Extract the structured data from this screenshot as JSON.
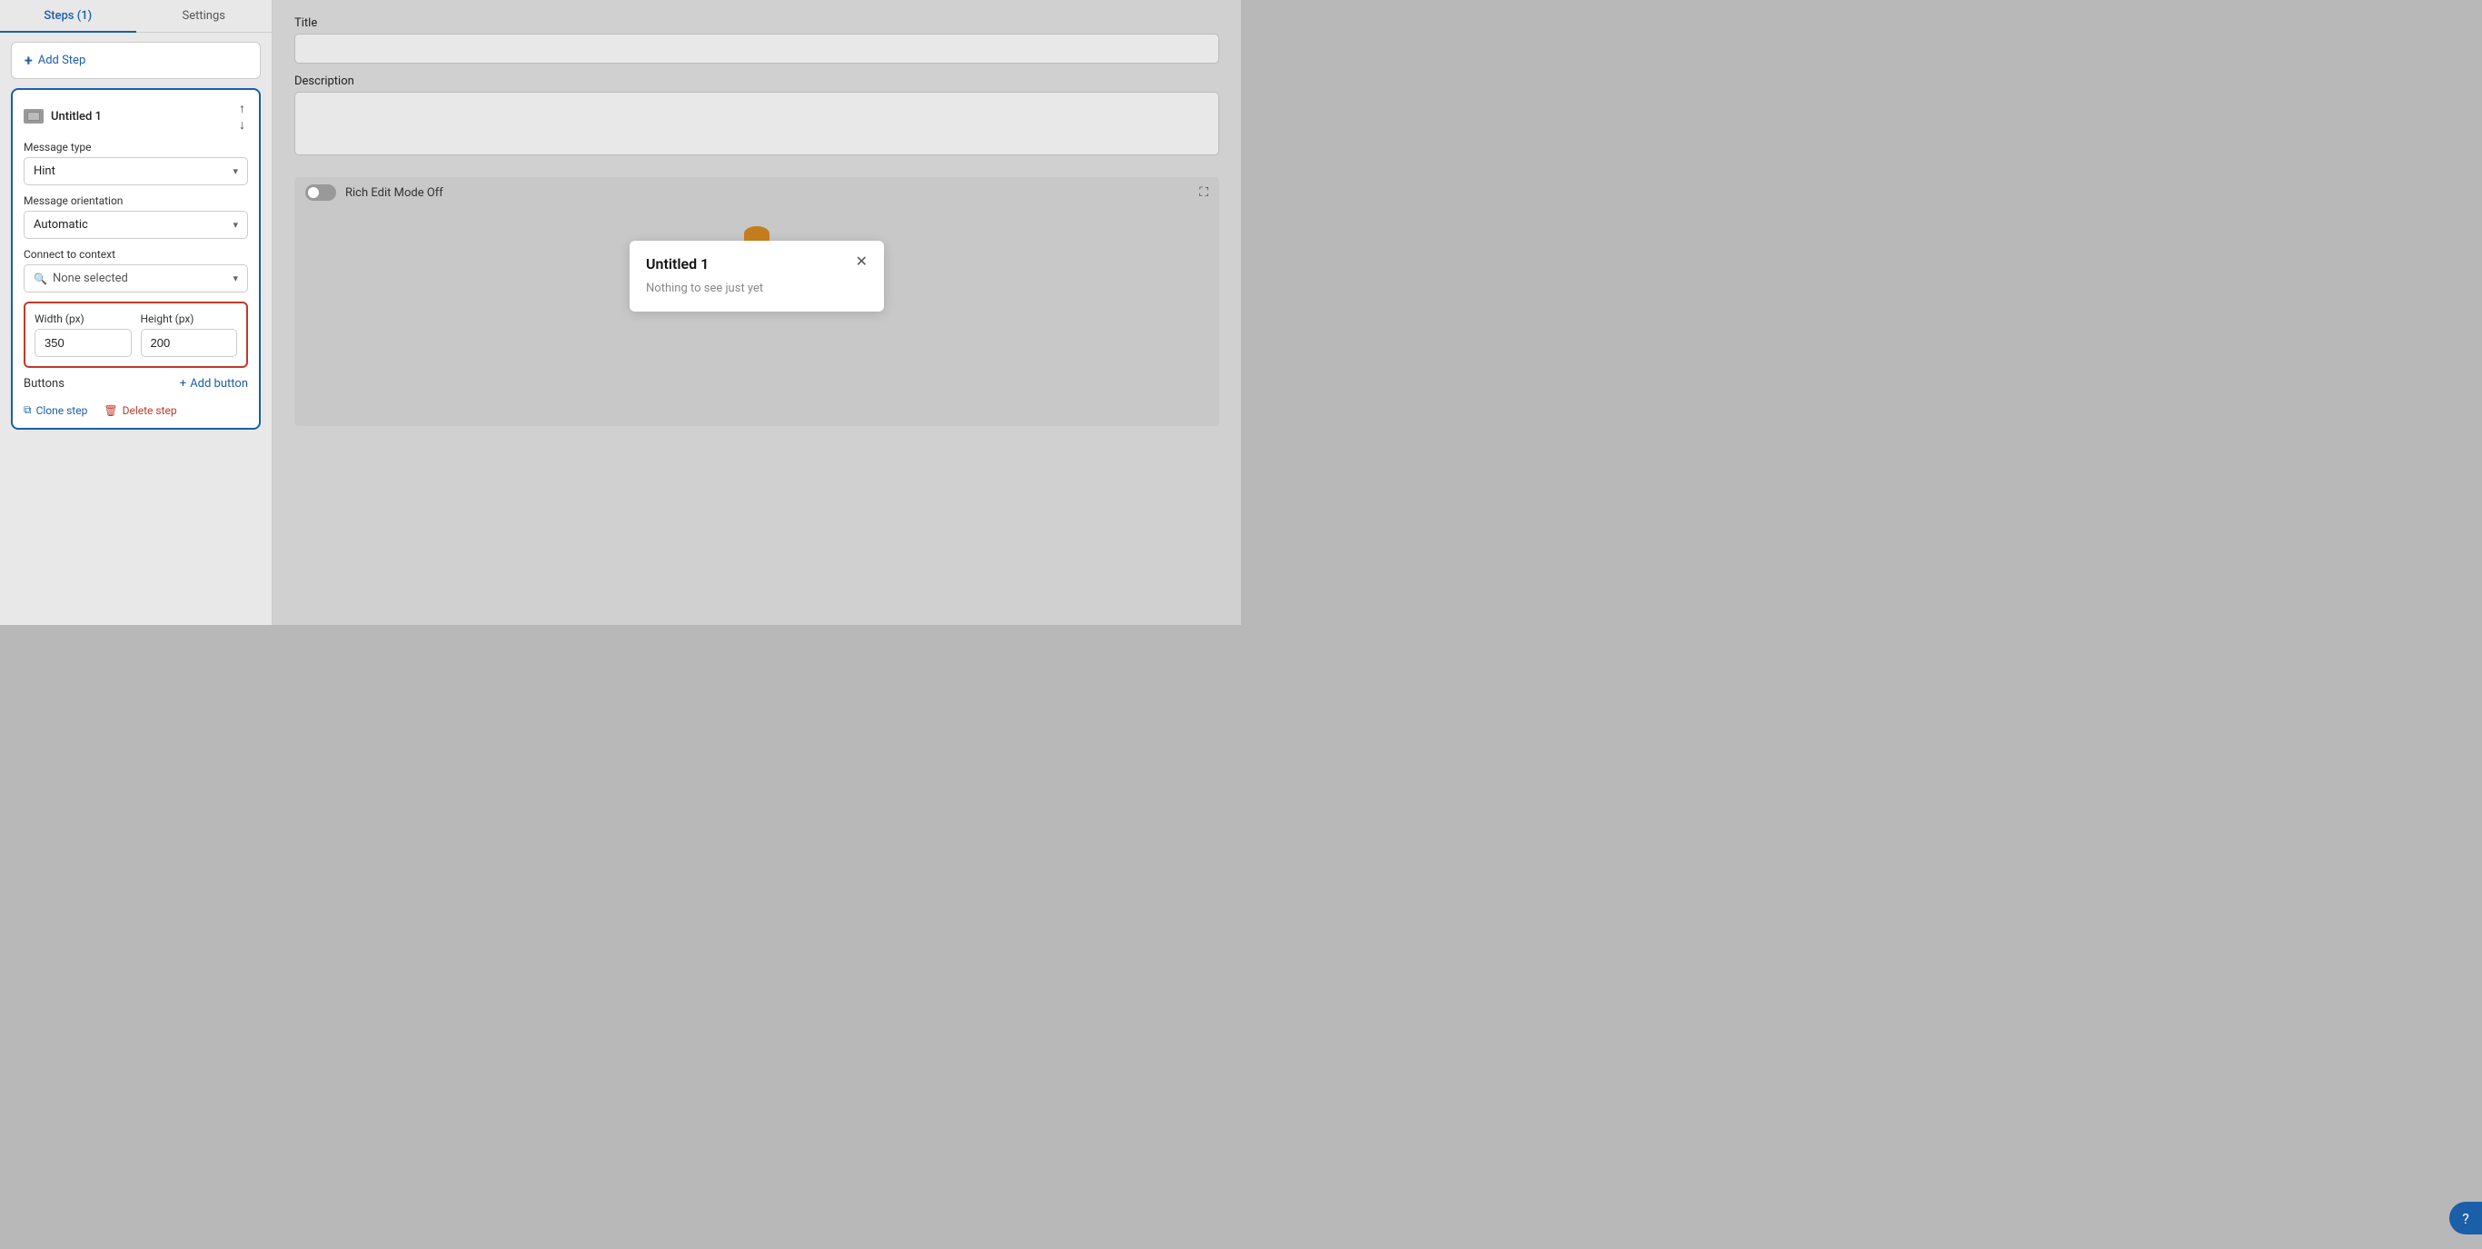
{
  "tabs": [
    {
      "id": "steps",
      "label": "Steps (1)",
      "active": true
    },
    {
      "id": "settings",
      "label": "Settings",
      "active": false
    }
  ],
  "add_step": {
    "label": "Add Step"
  },
  "step_card": {
    "name": "Untitled 1",
    "message_type": {
      "label": "Message type",
      "value": "Hint"
    },
    "message_orientation": {
      "label": "Message orientation",
      "value": "Automatic"
    },
    "connect_to_context": {
      "label": "Connect to context",
      "placeholder": "None selected"
    },
    "width": {
      "label": "Width (px)",
      "value": "350"
    },
    "height": {
      "label": "Height (px)",
      "value": "200"
    },
    "buttons_label": "Buttons",
    "add_button_label": "Add button",
    "clone_label": "Clone step",
    "delete_label": "Delete step"
  },
  "right_panel": {
    "title_label": "Title",
    "title_value": "",
    "description_label": "Description",
    "description_value": "",
    "rich_edit_label": "Rich Edit Mode Off",
    "preview": {
      "popup_title": "Untitled 1",
      "popup_body": "Nothing to see just yet"
    }
  },
  "chat_button": "?"
}
